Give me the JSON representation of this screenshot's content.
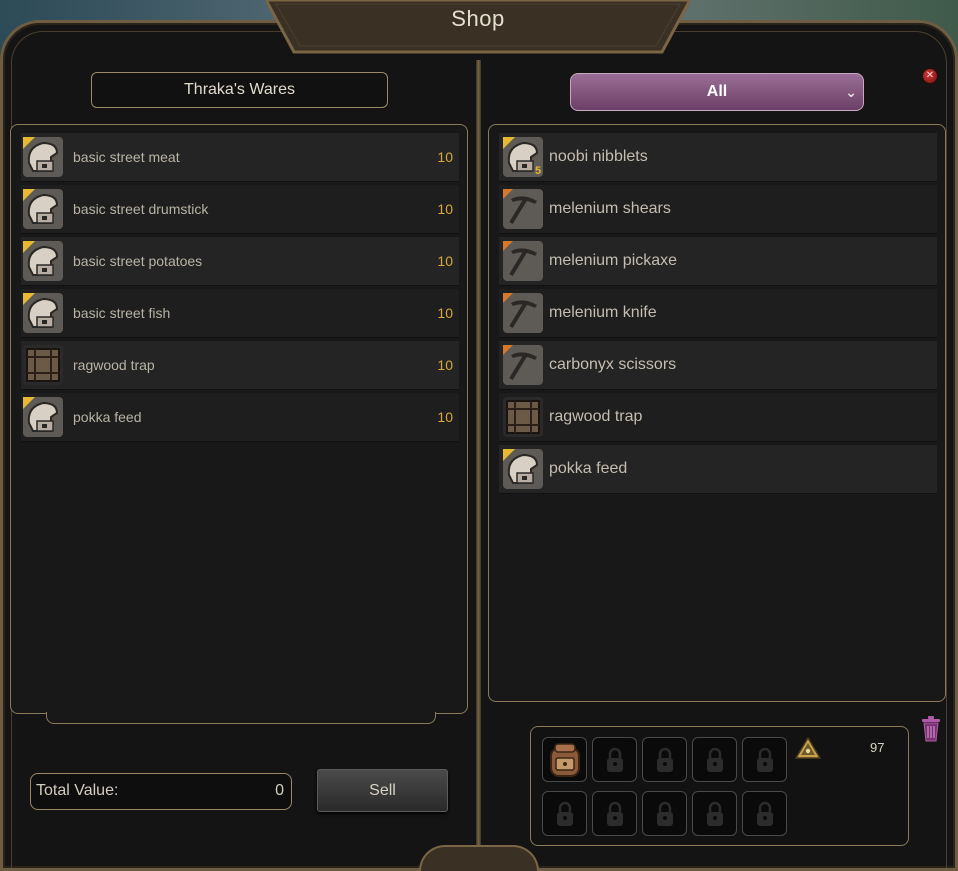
{
  "window": {
    "title": "Shop",
    "close_icon": "close-icon"
  },
  "vendor": {
    "name": "Thraka's Wares",
    "items": [
      {
        "name": "basic street meat",
        "price": "10",
        "icon": "food-sack-icon"
      },
      {
        "name": "basic street drumstick",
        "price": "10",
        "icon": "food-sack-icon"
      },
      {
        "name": "basic street potatoes",
        "price": "10",
        "icon": "food-sack-icon"
      },
      {
        "name": "basic street fish",
        "price": "10",
        "icon": "food-sack-icon"
      },
      {
        "name": "ragwood trap",
        "price": "10",
        "icon": "crate-icon"
      },
      {
        "name": "pokka feed",
        "price": "10",
        "icon": "food-sack-icon"
      }
    ]
  },
  "filter": {
    "selected": "All",
    "icon": "chevron-down-icon"
  },
  "player": {
    "items": [
      {
        "name": "noobi nibblets",
        "icon": "food-sack-icon",
        "quantity": "5"
      },
      {
        "name": "melenium shears",
        "icon": "pickaxe-icon"
      },
      {
        "name": "melenium pickaxe",
        "icon": "pickaxe-icon"
      },
      {
        "name": "melenium knife",
        "icon": "pickaxe-icon"
      },
      {
        "name": "carbonyx scissors",
        "icon": "pickaxe-icon"
      },
      {
        "name": "ragwood trap",
        "icon": "crate-icon"
      },
      {
        "name": "pokka feed",
        "icon": "food-sack-icon"
      }
    ]
  },
  "sell_panel": {
    "total_label": "Total Value:",
    "total_value": "0",
    "sell_label": "Sell"
  },
  "inventory": {
    "count": "97",
    "slots": [
      "backpack-icon",
      "lock-icon",
      "lock-icon",
      "lock-icon",
      "lock-icon",
      "lock-icon",
      "lock-icon",
      "lock-icon",
      "lock-icon",
      "lock-icon"
    ]
  },
  "colors": {
    "price": "#d8a93a",
    "filter_accent": "#8a5a85",
    "border_gold": "#8a7a5a"
  }
}
